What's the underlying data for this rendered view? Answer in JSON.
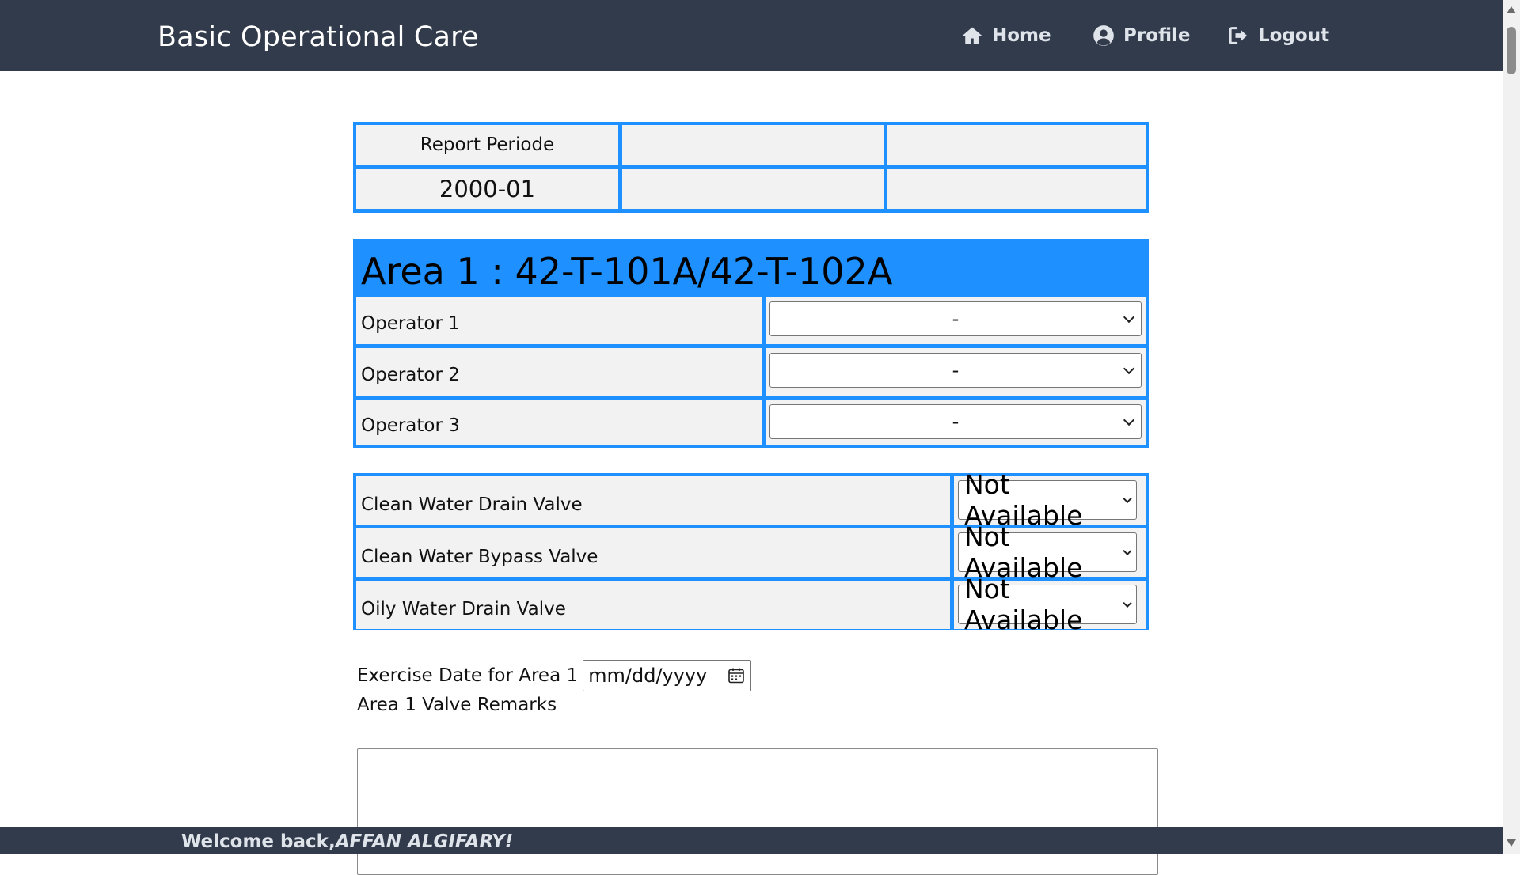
{
  "app": {
    "brand": "Basic Operational Care"
  },
  "nav": {
    "home": {
      "label": "Home",
      "icon": "home-icon"
    },
    "profile": {
      "label": "Profile",
      "icon": "user-circle-icon"
    },
    "logout": {
      "label": "Logout",
      "icon": "logout-icon"
    }
  },
  "report": {
    "label": "Report Periode",
    "value": "2000-01"
  },
  "area": {
    "title": "Area 1 : 42-T-101A/42-T-102A",
    "operators": [
      {
        "label": "Operator 1",
        "value": "-"
      },
      {
        "label": "Operator 2",
        "value": "-"
      },
      {
        "label": "Operator 3",
        "value": "-"
      }
    ],
    "valves": [
      {
        "label": "Clean Water Drain Valve",
        "value": "Not Available"
      },
      {
        "label": "Clean Water Bypass Valve",
        "value": "Not Available"
      },
      {
        "label": "Oily Water Drain Valve",
        "value": "Not Available"
      }
    ],
    "exercise_date_label": "Exercise Date for Area 1",
    "exercise_date_placeholder": "mm/dd/yyyy",
    "remarks_label": "Area 1 Valve Remarks",
    "remarks_value": ""
  },
  "footer": {
    "welcome_prefix": "Welcome back,",
    "user_name": "AFFAN ALGIFARY!"
  },
  "colors": {
    "navbar": "#323b4b",
    "table_border": "#1e90ff",
    "cell_background": "#f2f2f2"
  }
}
